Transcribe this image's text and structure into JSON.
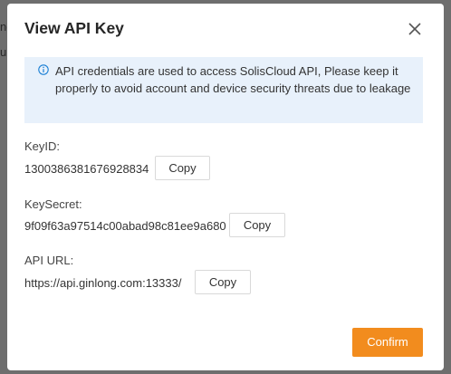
{
  "backdrop": {
    "fragment_1": "nc",
    "fragment_2": "u"
  },
  "dialog": {
    "title": "View API Key",
    "close_icon": "close-icon",
    "info": {
      "icon": "info-circle-icon",
      "text": "API credentials are used to access SolisCloud API, Please keep it properly to avoid account and device security threats due to leakage"
    },
    "key_id": {
      "label": "KeyID:",
      "value": "1300386381676928834",
      "copy_label": "Copy"
    },
    "key_secret": {
      "label": "KeySecret:",
      "value": "9f09f63a97514c00abad98c81ee9a680",
      "copy_label": "Copy"
    },
    "api_url": {
      "label": "API URL:",
      "value": "https://api.ginlong.com:13333/",
      "copy_label": "Copy"
    },
    "confirm_label": "Confirm"
  },
  "colors": {
    "accent": "#f28c1e",
    "info_background": "#e8f1fb",
    "info_icon": "#1a7fd4",
    "overlay": "#6e6e6e"
  }
}
